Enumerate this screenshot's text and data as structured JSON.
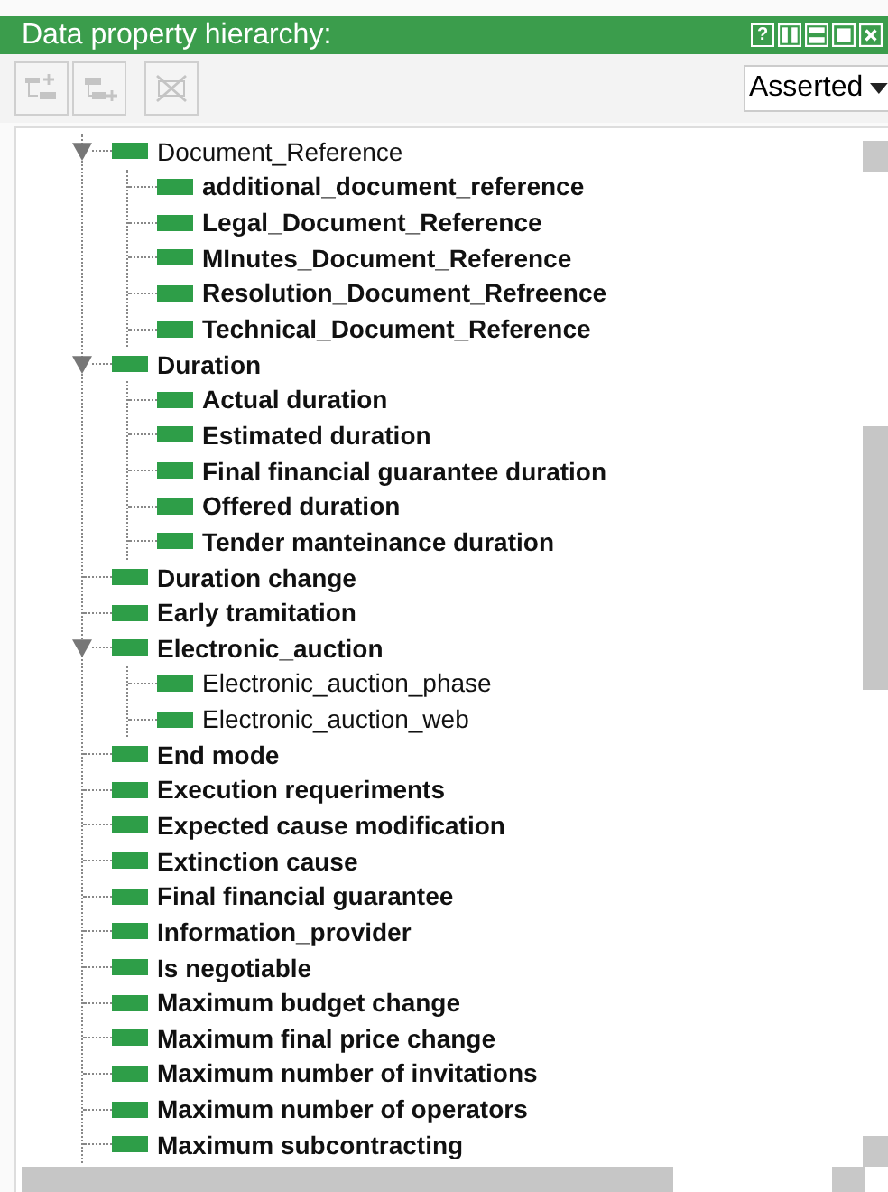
{
  "header": {
    "title": "Data property hierarchy:",
    "controls": [
      "?"
    ]
  },
  "toolbar": {
    "buttons": [
      {
        "kind": "add-sub",
        "disabled": true
      },
      {
        "kind": "add-sibling",
        "disabled": true
      },
      {
        "kind": "delete",
        "disabled": true
      }
    ],
    "view_select": {
      "value": "Asserted"
    }
  },
  "tree": {
    "items": [
      {
        "label": "Document_Reference",
        "bold": false,
        "expanded": true,
        "children": [
          {
            "label": "additional_document_reference",
            "bold": true
          },
          {
            "label": "Legal_Document_Reference",
            "bold": true
          },
          {
            "label": "MInutes_Document_Reference",
            "bold": true
          },
          {
            "label": "Resolution_Document_Refreence",
            "bold": true
          },
          {
            "label": "Technical_Document_Reference",
            "bold": true
          }
        ]
      },
      {
        "label": "Duration",
        "bold": true,
        "expanded": true,
        "children": [
          {
            "label": "Actual duration",
            "bold": true
          },
          {
            "label": "Estimated duration",
            "bold": true
          },
          {
            "label": "Final financial guarantee duration",
            "bold": true
          },
          {
            "label": "Offered duration",
            "bold": true
          },
          {
            "label": "Tender manteinance duration",
            "bold": true
          }
        ]
      },
      {
        "label": "Duration change",
        "bold": true
      },
      {
        "label": "Early tramitation",
        "bold": true
      },
      {
        "label": "Electronic_auction",
        "bold": true,
        "expanded": true,
        "children": [
          {
            "label": "Electronic_auction_phase",
            "bold": false
          },
          {
            "label": "Electronic_auction_web",
            "bold": false
          }
        ]
      },
      {
        "label": "End mode",
        "bold": true
      },
      {
        "label": "Execution requeriments",
        "bold": true
      },
      {
        "label": "Expected cause modification",
        "bold": true
      },
      {
        "label": "Extinction cause",
        "bold": true
      },
      {
        "label": "Final financial guarantee",
        "bold": true
      },
      {
        "label": "Information_provider",
        "bold": true
      },
      {
        "label": "Is negotiable",
        "bold": true
      },
      {
        "label": "Maximum budget change",
        "bold": true
      },
      {
        "label": "Maximum final price change",
        "bold": true
      },
      {
        "label": "Maximum number of invitations",
        "bold": true
      },
      {
        "label": "Maximum number of operators",
        "bold": true
      },
      {
        "label": "Maximum subcontracting",
        "bold": true
      }
    ]
  }
}
